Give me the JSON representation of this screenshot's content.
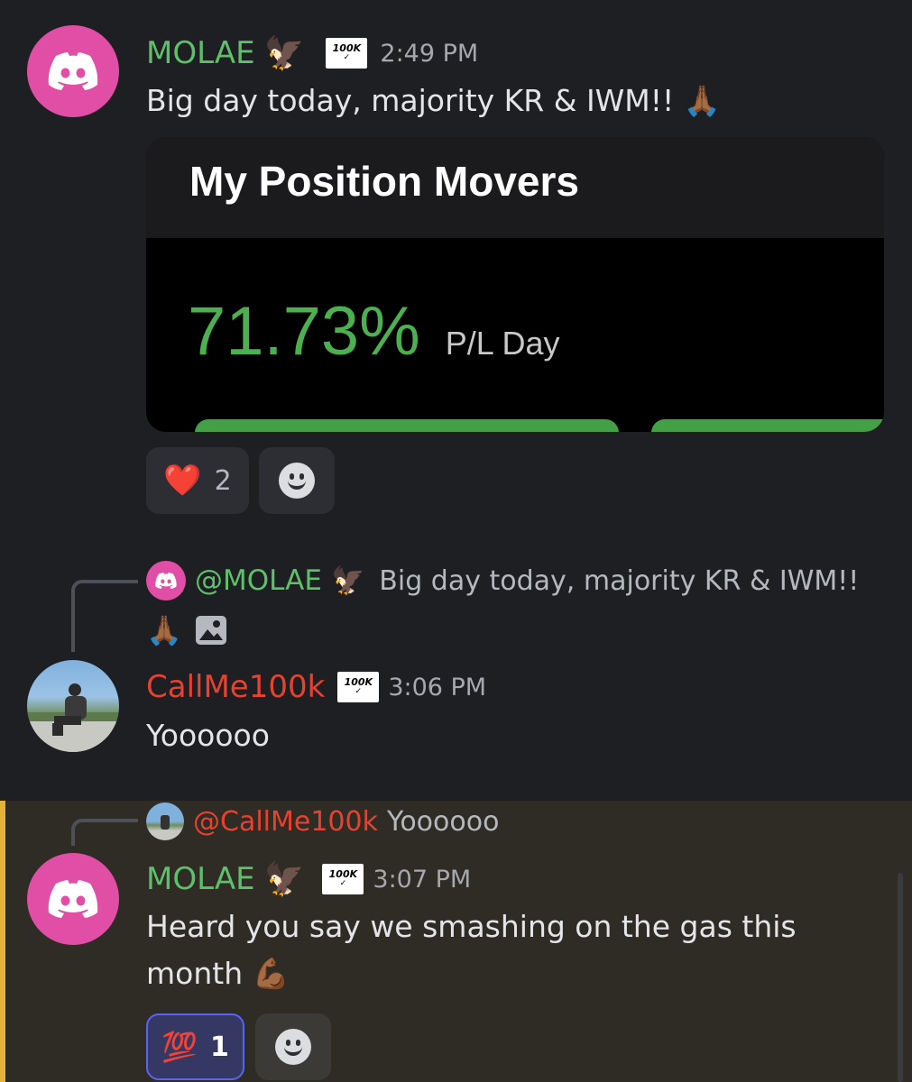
{
  "messages": [
    {
      "username": "MOLAE",
      "user_emoji": "🦅",
      "timestamp": "2:49 PM",
      "text": "Big day today, majority KR & IWM!!",
      "text_emoji": "🙏🏾",
      "embed": {
        "title": "My Position Movers",
        "value": "71.73%",
        "label": "P/L Day"
      },
      "reactions": [
        {
          "emoji": "❤️",
          "count": "2"
        }
      ]
    },
    {
      "reply": {
        "username": "@MOLAE",
        "user_emoji": "🦅",
        "text": "Big day today, majority KR & IWM!!",
        "text_emoji": "🙏🏾"
      },
      "username": "CallMe100k",
      "timestamp": "3:06 PM",
      "text": "Yoooooo"
    },
    {
      "reply": {
        "username": "@CallMe100k",
        "text": "Yoooooo"
      },
      "username": "MOLAE",
      "user_emoji": "🦅",
      "timestamp": "3:07 PM",
      "text_line1": "Heard you say we smashing on the gas this",
      "text_line2": "month",
      "text_emoji": "💪🏾",
      "reactions": [
        {
          "emoji": "💯",
          "count": "1"
        }
      ]
    }
  ],
  "badge": {
    "line1": "100K",
    "line2": "✓ "
  },
  "colors": {
    "background": "#1e1f23",
    "highlight_bg": "#2f2c26",
    "highlight_bar": "#e6b13a",
    "green_name": "#5fbf6a",
    "red_name": "#e5432f",
    "profit_green": "#4caf50",
    "avatar_pink": "#e04fa5"
  },
  "icons": [
    "discord-logo-icon",
    "smile-add-reaction-icon",
    "image-attachment-icon",
    "badge-100k-icon"
  ]
}
